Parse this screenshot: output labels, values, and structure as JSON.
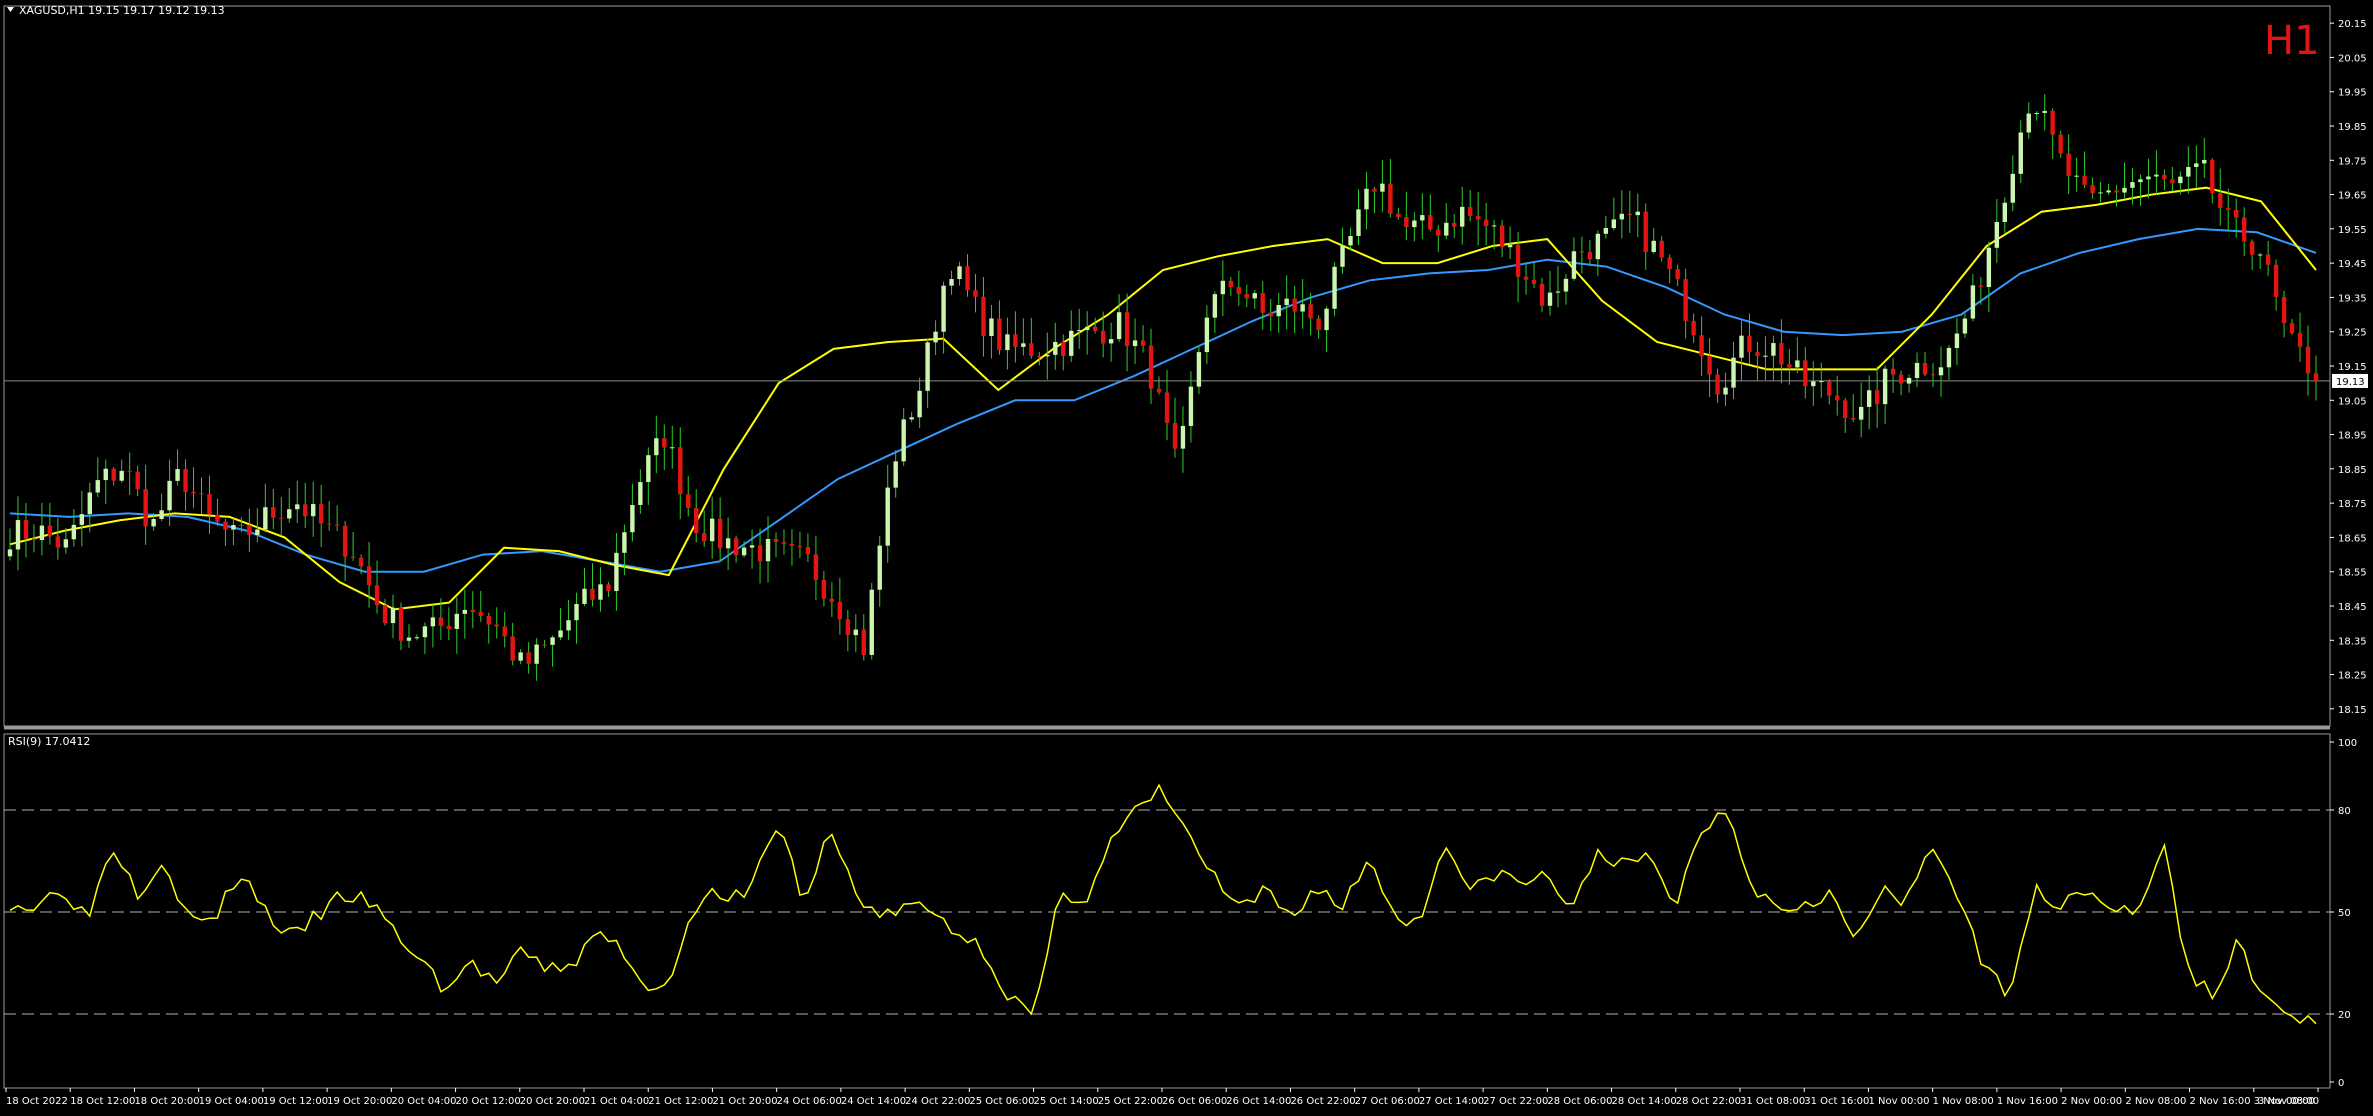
{
  "header": {
    "symbol_info": "XAGUSD,H1  19.15 19.17 19.12 19.13",
    "timeframe_badge": "H1",
    "price_marker": "19.13"
  },
  "rsi": {
    "label": "RSI(9) 17.0412",
    "levels": [
      80,
      50,
      20
    ],
    "ylim": [
      0,
      100
    ],
    "tick_labels": [
      "100",
      "80",
      "50",
      "20",
      "0"
    ]
  },
  "colors": {
    "background": "#000000",
    "bull_candle": "#ccf5b0",
    "bear_candle": "#e31414",
    "wick": "#2dcc2d",
    "ma_fast": "#ffff00",
    "ma_slow": "#3399ff",
    "rsi_line": "#ffff00",
    "grid_text": "#ffffff",
    "h1_badge": "#e31414",
    "current_price_line": "#8a8a8a"
  },
  "x_axis_labels": [
    "18 Oct 2022",
    "18 Oct 12:00",
    "18 Oct 20:00",
    "19 Oct 04:00",
    "19 Oct 12:00",
    "19 Oct 20:00",
    "20 Oct 04:00",
    "20 Oct 12:00",
    "20 Oct 20:00",
    "21 Oct 04:00",
    "21 Oct 12:00",
    "21 Oct 20:00",
    "24 Oct 06:00",
    "24 Oct 14:00",
    "24 Oct 22:00",
    "25 Oct 06:00",
    "25 Oct 14:00",
    "25 Oct 22:00",
    "26 Oct 06:00",
    "26 Oct 14:00",
    "26 Oct 22:00",
    "27 Oct 06:00",
    "27 Oct 14:00",
    "27 Oct 22:00",
    "28 Oct 06:00",
    "28 Oct 14:00",
    "28 Oct 22:00",
    "31 Oct 08:00",
    "31 Oct 16:00",
    "1 Nov 00:00",
    "1 Nov 08:00",
    "1 Nov 16:00",
    "2 Nov 00:00",
    "2 Nov 08:00",
    "2 Nov 16:00",
    "3 Nov 00:00",
    "3 Nov 08:00"
  ],
  "chart_data": [
    {
      "type": "candlestick",
      "title": "XAGUSD,H1",
      "ylim": [
        18.1,
        20.2
      ],
      "y_tick_labels": [
        "20.15",
        "20.05",
        "19.95",
        "19.85",
        "19.75",
        "19.65",
        "19.55",
        "19.45",
        "19.35",
        "19.25",
        "19.15",
        "19.05",
        "18.95",
        "18.85",
        "18.75",
        "18.65",
        "18.55",
        "18.45",
        "18.35",
        "18.25",
        "18.15"
      ],
      "close_anchors": [
        18.66,
        18.67,
        18.62,
        18.8,
        18.86,
        18.68,
        18.84,
        18.7,
        18.64,
        18.71,
        18.76,
        18.68,
        18.62,
        18.44,
        18.37,
        18.38,
        18.46,
        18.4,
        18.27,
        18.34,
        18.45,
        18.51,
        18.8,
        18.95,
        18.7,
        18.64,
        18.62,
        18.6,
        18.58,
        18.47,
        18.33,
        18.87,
        19.1,
        19.46,
        19.3,
        19.2,
        19.2,
        19.22,
        19.25,
        19.27,
        19.15,
        18.84,
        19.31,
        19.4,
        19.3,
        19.33,
        19.28,
        19.5,
        19.7,
        19.55,
        19.55,
        19.6,
        19.55,
        19.45,
        19.33,
        19.48,
        19.52,
        19.58,
        19.46,
        19.3,
        19.1,
        19.22,
        19.2,
        19.1,
        19.07,
        19.0,
        19.12,
        19.15,
        19.17,
        19.35,
        19.65,
        19.95,
        19.75,
        19.62,
        19.67,
        19.7,
        19.67,
        19.72,
        19.55,
        19.5,
        19.22,
        19.13
      ],
      "ma_fast": [
        18.63,
        18.67,
        18.7,
        18.72,
        18.71,
        18.65,
        18.52,
        18.44,
        18.46,
        18.62,
        18.61,
        18.57,
        18.54,
        18.85,
        19.1,
        19.2,
        19.22,
        19.23,
        19.08,
        19.2,
        19.3,
        19.43,
        19.47,
        19.5,
        19.52,
        19.45,
        19.45,
        19.5,
        19.52,
        19.34,
        19.22,
        19.18,
        19.14,
        19.14,
        19.14,
        19.3,
        19.5,
        19.6,
        19.62,
        19.65,
        19.67,
        19.63,
        19.43
      ],
      "ma_slow": [
        18.72,
        18.71,
        18.72,
        18.71,
        18.67,
        18.6,
        18.55,
        18.55,
        18.6,
        18.61,
        18.58,
        18.55,
        18.58,
        18.7,
        18.82,
        18.9,
        18.98,
        19.05,
        19.05,
        19.12,
        19.2,
        19.28,
        19.35,
        19.4,
        19.42,
        19.43,
        19.46,
        19.44,
        19.38,
        19.3,
        19.25,
        19.24,
        19.25,
        19.3,
        19.42,
        19.48,
        19.52,
        19.55,
        19.54,
        19.48
      ]
    },
    {
      "type": "line",
      "title": "RSI(9) 17.0412",
      "ylim": [
        0,
        100
      ],
      "levels": [
        20,
        50,
        80
      ],
      "values": [
        53,
        51,
        58,
        48,
        70,
        56,
        66,
        47,
        48,
        62,
        50,
        42,
        49,
        55,
        53,
        44,
        36,
        27,
        35,
        29,
        38,
        33,
        35,
        44,
        38,
        26,
        35,
        56,
        52,
        59,
        77,
        52,
        74,
        56,
        48,
        52,
        50,
        44,
        39,
        25,
        19,
        56,
        54,
        71,
        80,
        86,
        72,
        60,
        50,
        56,
        48,
        58,
        51,
        66,
        50,
        46,
        72,
        55,
        62,
        58,
        61,
        50,
        69,
        63,
        66,
        52,
        74,
        81,
        58,
        51,
        53,
        56,
        41,
        56,
        52,
        70,
        56,
        33,
        27,
        56,
        53,
        57,
        52,
        48,
        71,
        33,
        25,
        42,
        23,
        20,
        17
      ]
    }
  ]
}
